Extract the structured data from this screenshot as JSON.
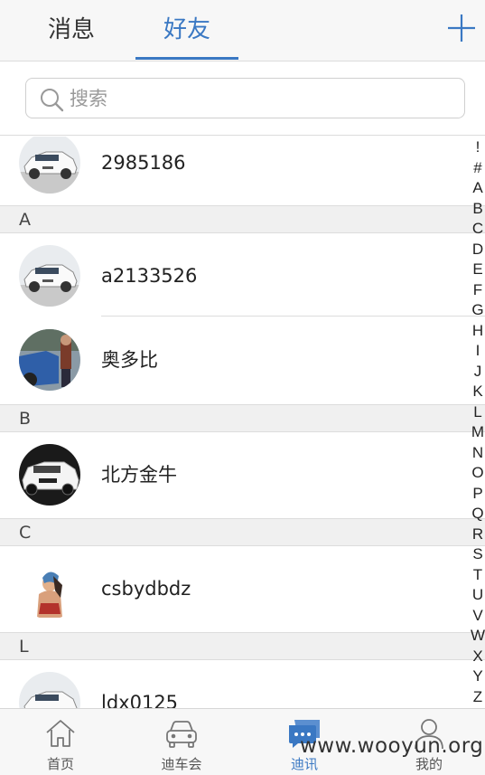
{
  "header": {
    "tabs": [
      {
        "label": "消息",
        "active": false
      },
      {
        "label": "好友",
        "active": true
      }
    ],
    "add_icon": "plus-icon"
  },
  "search": {
    "placeholder": "搜索",
    "value": ""
  },
  "contacts": {
    "first": {
      "name": "2985186",
      "avatar": "white-car"
    },
    "sections": [
      {
        "letter": "A",
        "items": [
          {
            "name": "a2133526",
            "avatar": "white-car"
          },
          {
            "name": "奥多比",
            "avatar": "blue-car-person"
          }
        ]
      },
      {
        "letter": "B",
        "items": [
          {
            "name": "北方金牛",
            "avatar": "white-suv"
          }
        ]
      },
      {
        "letter": "C",
        "items": [
          {
            "name": "csbydbdz",
            "avatar": "person-photo"
          }
        ]
      },
      {
        "letter": "L",
        "items": [
          {
            "name": "ldx0125",
            "avatar": "white-car"
          }
        ]
      }
    ]
  },
  "index_letters": [
    "!",
    "#",
    "A",
    "B",
    "C",
    "D",
    "E",
    "F",
    "G",
    "H",
    "I",
    "J",
    "K",
    "L",
    "M",
    "N",
    "O",
    "P",
    "Q",
    "R",
    "S",
    "T",
    "U",
    "V",
    "W",
    "X",
    "Y",
    "Z"
  ],
  "bottom_nav": [
    {
      "label": "首页",
      "icon": "home-icon",
      "active": false
    },
    {
      "label": "迪车会",
      "icon": "car-icon",
      "active": false
    },
    {
      "label": "迪讯",
      "icon": "chat-icon",
      "active": true
    },
    {
      "label": "我的",
      "icon": "person-icon",
      "active": false
    }
  ],
  "watermark": "www.wooyun.org",
  "colors": {
    "accent": "#3a78c3",
    "section_bg": "#f0f0f0",
    "header_bg": "#f7f7f7"
  }
}
